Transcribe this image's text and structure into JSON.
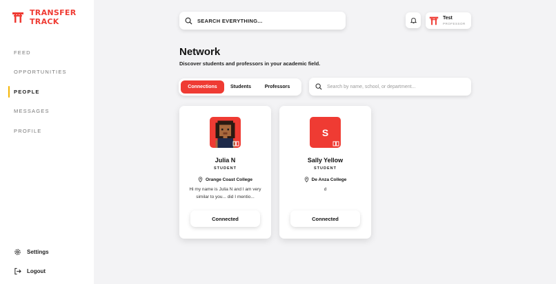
{
  "app": {
    "logo_line1": "TRANSFER",
    "logo_line2": "TRACK",
    "brand_color": "#ef3b33"
  },
  "sidebar": {
    "items": [
      {
        "label": "FEED",
        "active": false
      },
      {
        "label": "OPPORTUNITIES",
        "active": false
      },
      {
        "label": "PEOPLE",
        "active": true
      },
      {
        "label": "MESSAGES",
        "active": false
      },
      {
        "label": "PROFILE",
        "active": false
      }
    ],
    "settings_label": "Settings",
    "logout_label": "Logout"
  },
  "header": {
    "search_placeholder": "SEARCH EVERYTHING...",
    "user": {
      "name": "Test",
      "role": "PROFESSOR"
    }
  },
  "main": {
    "title": "Network",
    "subtitle": "Discover students and professors in your academic field.",
    "tabs": [
      {
        "label": "Connections",
        "active": true
      },
      {
        "label": "Students",
        "active": false
      },
      {
        "label": "Professors",
        "active": false
      }
    ],
    "filter_placeholder": "Search by name, school, or department...",
    "cards": [
      {
        "name": "Julia N",
        "role": "STUDENT",
        "school": "Orange Coast College",
        "bio": "Hi my name is Julia N and I am very similar to you... did I mentio...",
        "button": "Connected",
        "avatar": "pixel-portrait"
      },
      {
        "name": "Sally Yellow",
        "role": "STUDENT",
        "school": "De Anza College",
        "bio": "d",
        "button": "Connected",
        "avatar_letter": "S"
      }
    ]
  }
}
